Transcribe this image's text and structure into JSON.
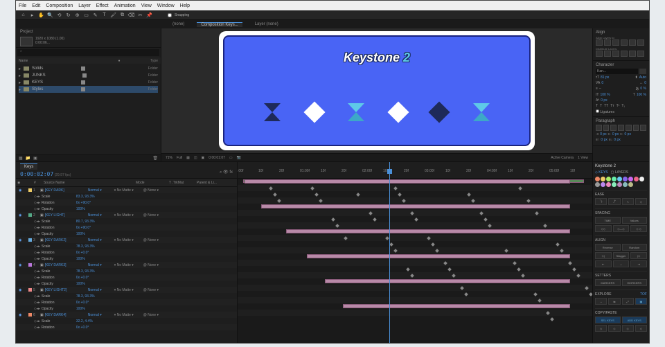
{
  "menubar": [
    "File",
    "Edit",
    "Composition",
    "Layer",
    "Effect",
    "Animation",
    "View",
    "Window",
    "Help"
  ],
  "toolbar_snapping": "Snapping",
  "tabs": {
    "items": [
      "(none)",
      "Composition Keys...",
      "Layer (none)"
    ],
    "active": 1
  },
  "project": {
    "label": "Project",
    "info": "1920 x 1080 (1.00)",
    "detail": "0:00:06...",
    "search": "⌕",
    "cols": {
      "name": "Name",
      "type": "Type"
    },
    "items": [
      {
        "name": "Solids",
        "type": "Folder"
      },
      {
        "name": "JUNKS",
        "type": "Folder"
      },
      {
        "name": "KEYS",
        "type": "Folder"
      },
      {
        "name": "Styles",
        "type": "Folder",
        "selected": true
      }
    ]
  },
  "canvas": {
    "title_a": "Keystone ",
    "title_b": "2"
  },
  "viewer_controls": {
    "zoom": "71%",
    "res": "Full",
    "cam": "Active Camera",
    "view": "1 View",
    "tc": "0:00:01:07"
  },
  "align": {
    "title": "Align",
    "to_label": "Align Layers to:",
    "dist_label": "Distribute Layers:"
  },
  "character": {
    "title": "Character",
    "font": "Kan...",
    "size": "81 px",
    "leading": "Auto",
    "tracking": "0",
    "kerning": "0",
    "vscale": "100 %",
    "hscale": "100 %",
    "baseline": "0 px",
    "tsume": "0 %",
    "ligatures": "Ligatures"
  },
  "paragraph": {
    "title": "Paragraph",
    "indent_l": "0 px",
    "indent_r": "0 px",
    "before": "0 px",
    "first": "0 px",
    "after": "0 px"
  },
  "timeline": {
    "comp_tab": "Keys",
    "timecode": "0:00:02:07",
    "fps_note": "(29.97 fps)",
    "cols": {
      "source": "Source Name",
      "mode": "Mode",
      "trk": "T .TrkMat",
      "parent": "Parent & Li..."
    },
    "ruler": [
      ":00f",
      "10f",
      "20f",
      "01:00f",
      "10f",
      "20f",
      "02:00f",
      "10f",
      "20f",
      "03:00f",
      "10f",
      "20f",
      "04:00f",
      "10f",
      "20f",
      "05:00f",
      "10f"
    ],
    "layers": [
      {
        "num": "1",
        "name": "[KEY DARK]",
        "mode": "Normal",
        "parent": "None",
        "bar": [
          10,
          480
        ]
      },
      {
        "prop": true,
        "name": "Scale",
        "val": "83.3, 93.3%"
      },
      {
        "prop": true,
        "name": "Rotation",
        "val": "0x +90.0°"
      },
      {
        "prop": true,
        "name": "Opacity",
        "val": "100%"
      },
      {
        "num": "2",
        "name": "[KEY LIGHT]",
        "mode": "Normal",
        "parent": "None",
        "bar": [
          34,
          480
        ]
      },
      {
        "prop": true,
        "name": "Scale",
        "val": "80.7, 93.3%"
      },
      {
        "prop": true,
        "name": "Rotation",
        "val": "0x +90.0°"
      },
      {
        "prop": true,
        "name": "Opacity",
        "val": "100%"
      },
      {
        "num": "3",
        "name": "[KEY DARK2]",
        "mode": "Normal",
        "parent": "None",
        "bar": [
          70,
          480
        ]
      },
      {
        "prop": true,
        "name": "Scale",
        "val": "78.3, 93.3%"
      },
      {
        "prop": true,
        "name": "Rotation",
        "val": "0x +0.0°"
      },
      {
        "prop": true,
        "name": "Opacity",
        "val": "100%"
      },
      {
        "num": "4",
        "name": "[KEY DARK3]",
        "mode": "Normal",
        "parent": "None",
        "bar": [
          100,
          480
        ]
      },
      {
        "prop": true,
        "name": "Scale",
        "val": "78.3, 93.3%"
      },
      {
        "prop": true,
        "name": "Rotation",
        "val": "0x +0.0°"
      },
      {
        "prop": true,
        "name": "Opacity",
        "val": "100%"
      },
      {
        "num": "5",
        "name": "[KEY LIGHT2]",
        "mode": "Normal",
        "parent": "None",
        "bar": [
          126,
          480
        ]
      },
      {
        "prop": true,
        "name": "Scale",
        "val": "78.3, 93.3%"
      },
      {
        "prop": true,
        "name": "Rotation",
        "val": "0x +0.0°"
      },
      {
        "prop": true,
        "name": "Opacity",
        "val": "100%"
      },
      {
        "num": "6",
        "name": "[KEY DARK4]",
        "mode": "Normal",
        "parent": "None",
        "bar": [
          152,
          480
        ]
      },
      {
        "prop": true,
        "name": "Scale",
        "val": "32.2, 4.4%"
      },
      {
        "prop": true,
        "name": "Rotation",
        "val": "0x +0.0°"
      }
    ]
  },
  "keystone": {
    "title": "Keystone 2",
    "tab_keys": "KEYS",
    "tab_layers": "LAYERS",
    "swatches": [
      "#e86",
      "#ec6",
      "#ae6",
      "#6ea",
      "#6ce",
      "#86e",
      "#c6e",
      "#e68",
      "#eee",
      "#999",
      "#b8e",
      "#e8b",
      "#8eb",
      "#b8b",
      "#8bb",
      "#bb8"
    ],
    "sections": {
      "ease": "EASE",
      "spacing": "SPACING",
      "time": "TIME",
      "values": "Values",
      "align": "ALIGN",
      "reverse": "Reverse",
      "random": "Random",
      "stagger": "Stagger",
      "setters": "SETTERS",
      "set_markers": "MARKERS",
      "set_workers": "WORKERS",
      "explore": "EXPLORE",
      "tof": "TOF",
      "copy_paste": "COPY/PASTE",
      "select": "SEL KEYS",
      "add_keys": "ADD KEYS"
    }
  }
}
